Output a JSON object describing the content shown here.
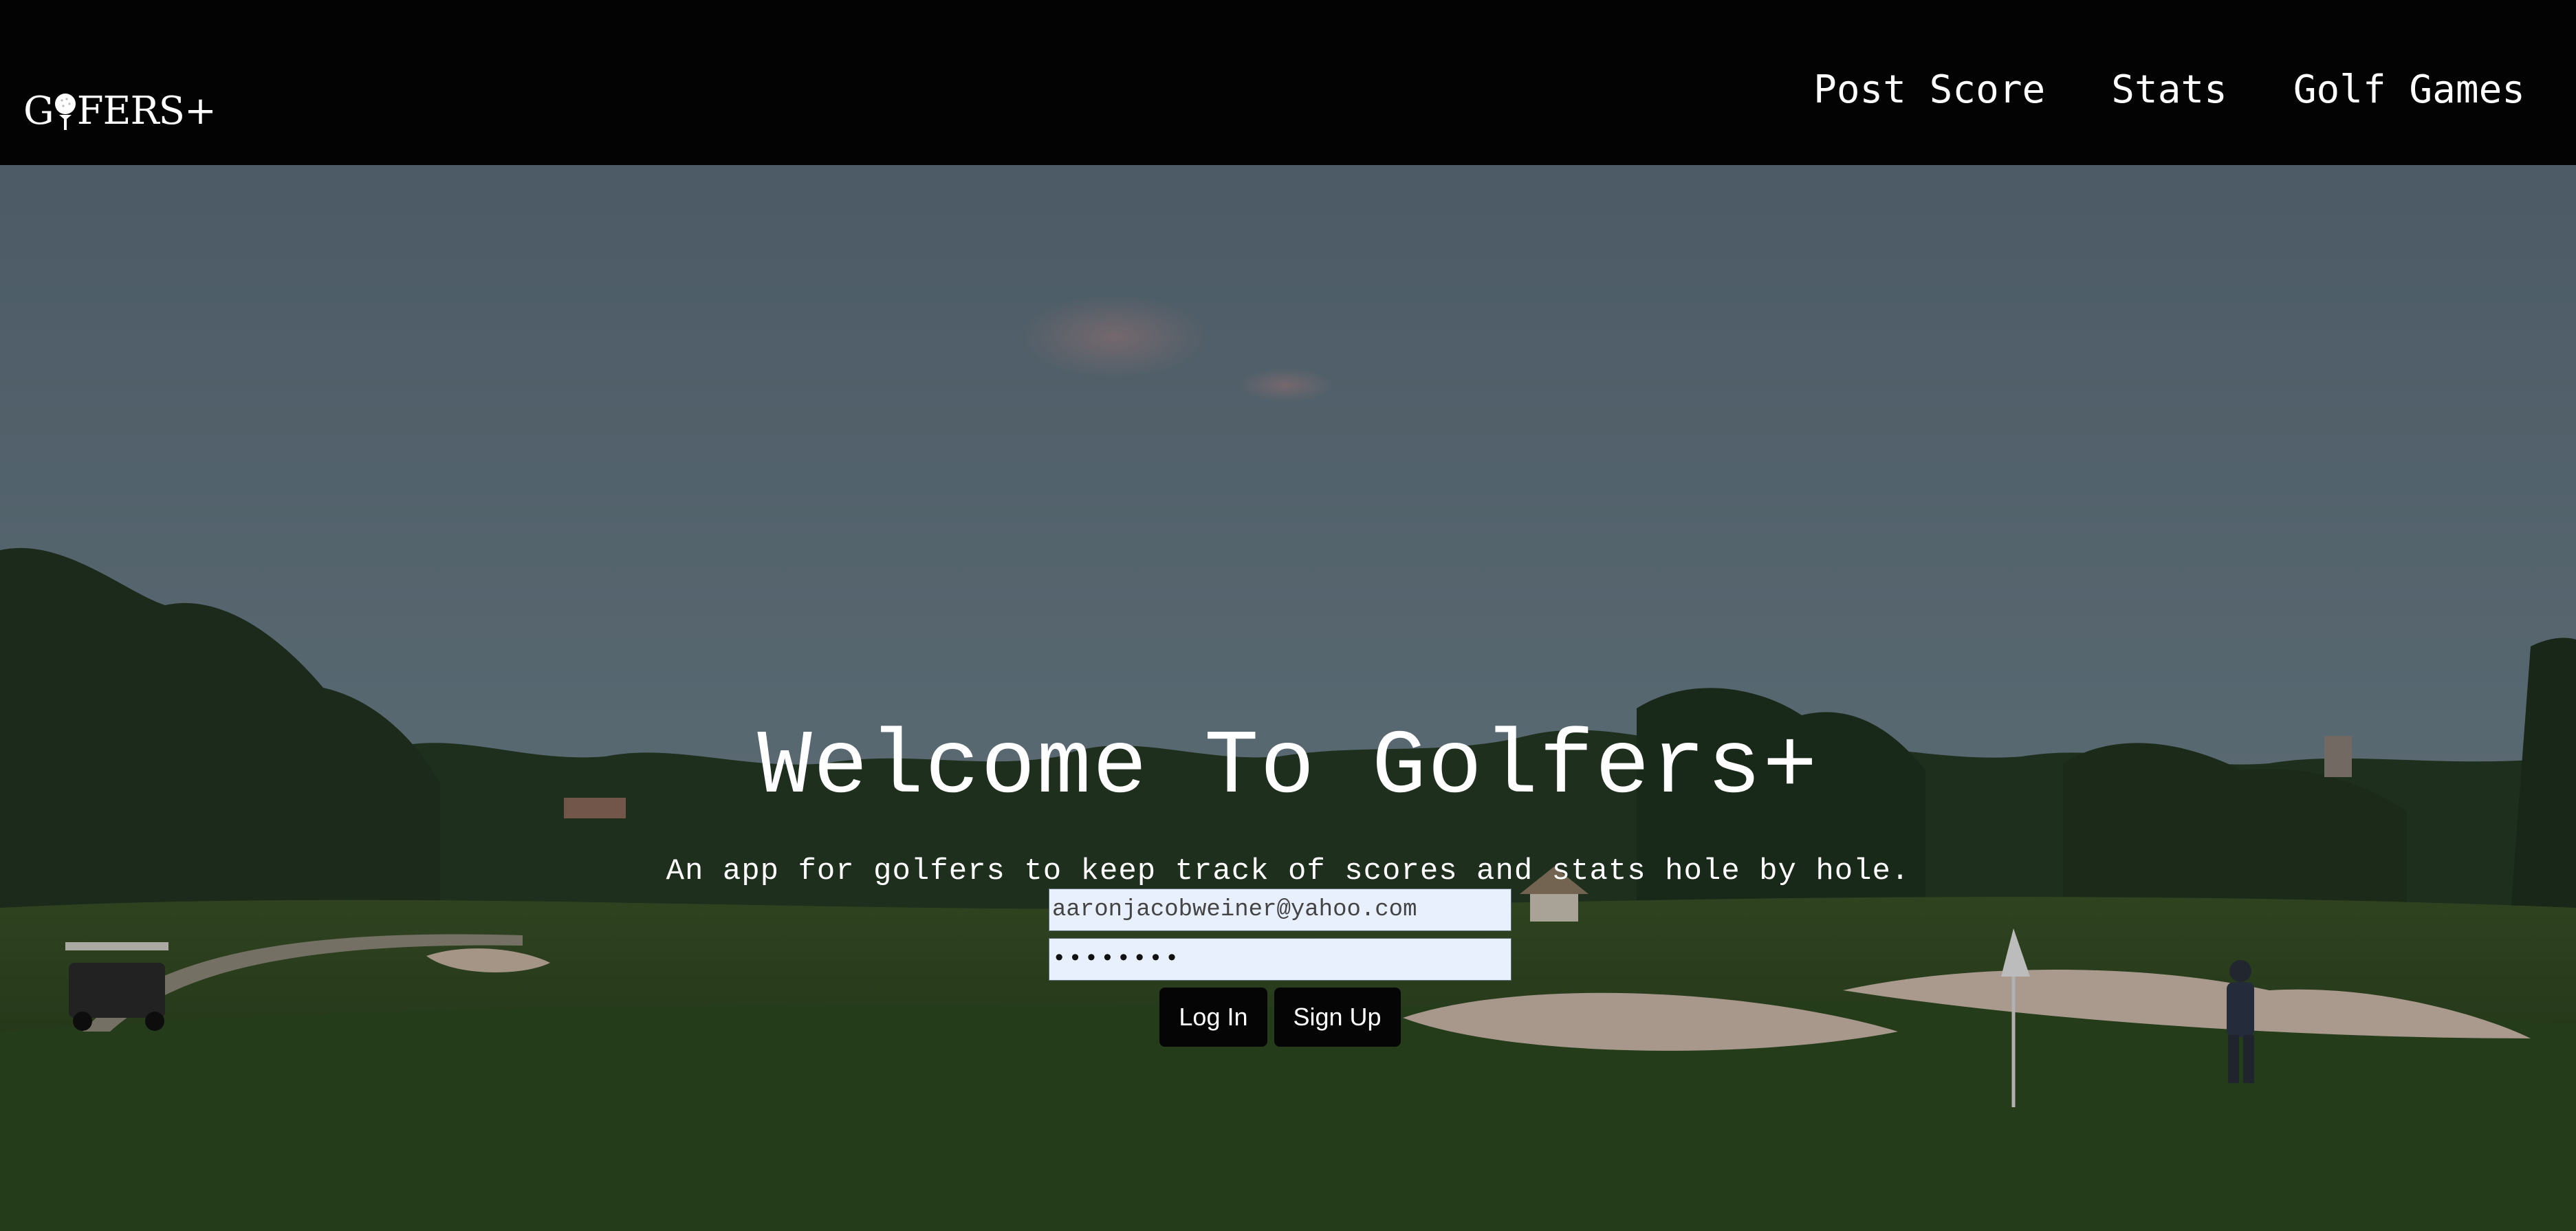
{
  "header": {
    "logo": {
      "text_before": "G",
      "text_after": "FERS+",
      "icon": "golf-ball-on-tee-icon"
    },
    "nav": [
      {
        "label": "Post Score"
      },
      {
        "label": "Stats"
      },
      {
        "label": "Golf Games"
      }
    ]
  },
  "hero": {
    "background": "golf-course-photo",
    "title": "Welcome To Golfers+",
    "subtitle": "An app for golfers to keep track of scores and stats hole by hole."
  },
  "login": {
    "email_value": "aaronjacobweiner@yahoo.com",
    "password_value": "••••••••",
    "login_label": "Log In",
    "signup_label": "Sign Up"
  },
  "colors": {
    "header_bg": "#030303",
    "input_bg": "#e8f0fe",
    "button_bg": "#050505"
  }
}
